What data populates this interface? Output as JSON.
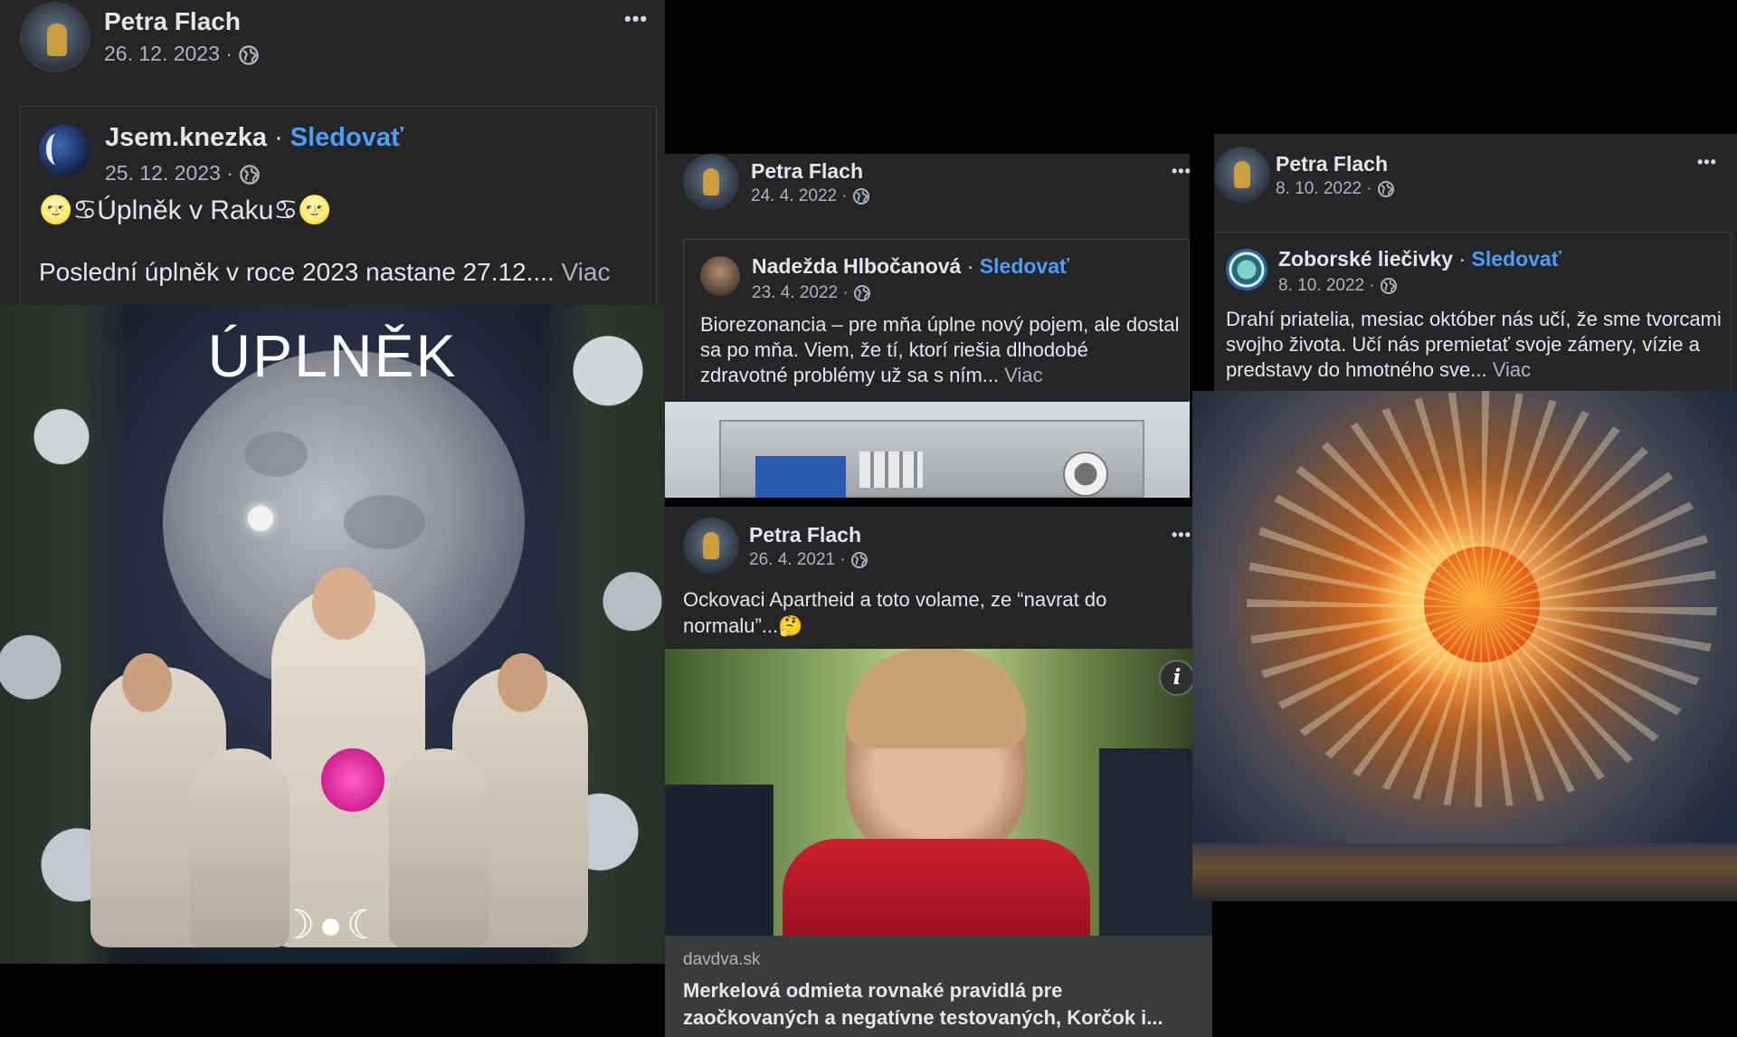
{
  "post1": {
    "author": "Petra Flach",
    "date": "26. 12. 2023",
    "more": "•••",
    "shared": {
      "author": "Jsem.knezka",
      "sep": "·",
      "follow": "Sledovať",
      "date": "25. 12. 2023",
      "headline_emoji_left": "🌝♋",
      "headline": "Úplněk v Raku",
      "headline_emoji_right": "♋🌝",
      "body": "Poslední úplněk v roce 2023 nastane 27.12....",
      "more_link": "Viac"
    },
    "image": {
      "overlay_title": "ÚPLNĚK",
      "moon_phases": "☽●☾"
    }
  },
  "post2": {
    "author": "Petra Flach",
    "date": "24. 4. 2022",
    "more": "•••",
    "shared": {
      "author": "Nadežda Hlbočanová",
      "sep": "·",
      "follow": "Sledovať",
      "date": "23. 4. 2022",
      "body": "Biorezonancia – pre mňa úplne nový pojem, ale dostal sa po mňa. Viem, že tí, ktorí riešia dlhodobé zdravotné problémy už sa s ním...",
      "more_link": "Viac"
    }
  },
  "post3": {
    "author": "Petra Flach",
    "date": "26. 4. 2021",
    "more": "•••",
    "body": "Ockovaci Apartheid a toto volame, ze “navrat do normalu”...",
    "body_emoji": "🤔",
    "info_icon_label": "i",
    "link": {
      "domain": "davdva.sk",
      "title": "Merkelová odmieta rovnaké pravidlá pre zaočkovaných a negatívne testovaných, Korčok i..."
    }
  },
  "post4": {
    "author": "Petra Flach",
    "date": "8. 10. 2022",
    "more": "•••",
    "shared": {
      "author": "Zoborské liečivky",
      "sep": "·",
      "follow": "Sledovať",
      "date": "8. 10. 2022",
      "body": "Drahí priatelia, mesiac október nás učí, že sme tvorcami svojho života. Učí nás premietať svoje zámery, vízie a predstavy do hmotného sve...",
      "more_link": "Viac"
    }
  },
  "common": {
    "dot": "·"
  },
  "colors": {
    "panel": "#242526",
    "text": "#e4e6eb",
    "meta": "#b0b3b8",
    "link": "#4b9ffb",
    "border": "#3e4042"
  }
}
